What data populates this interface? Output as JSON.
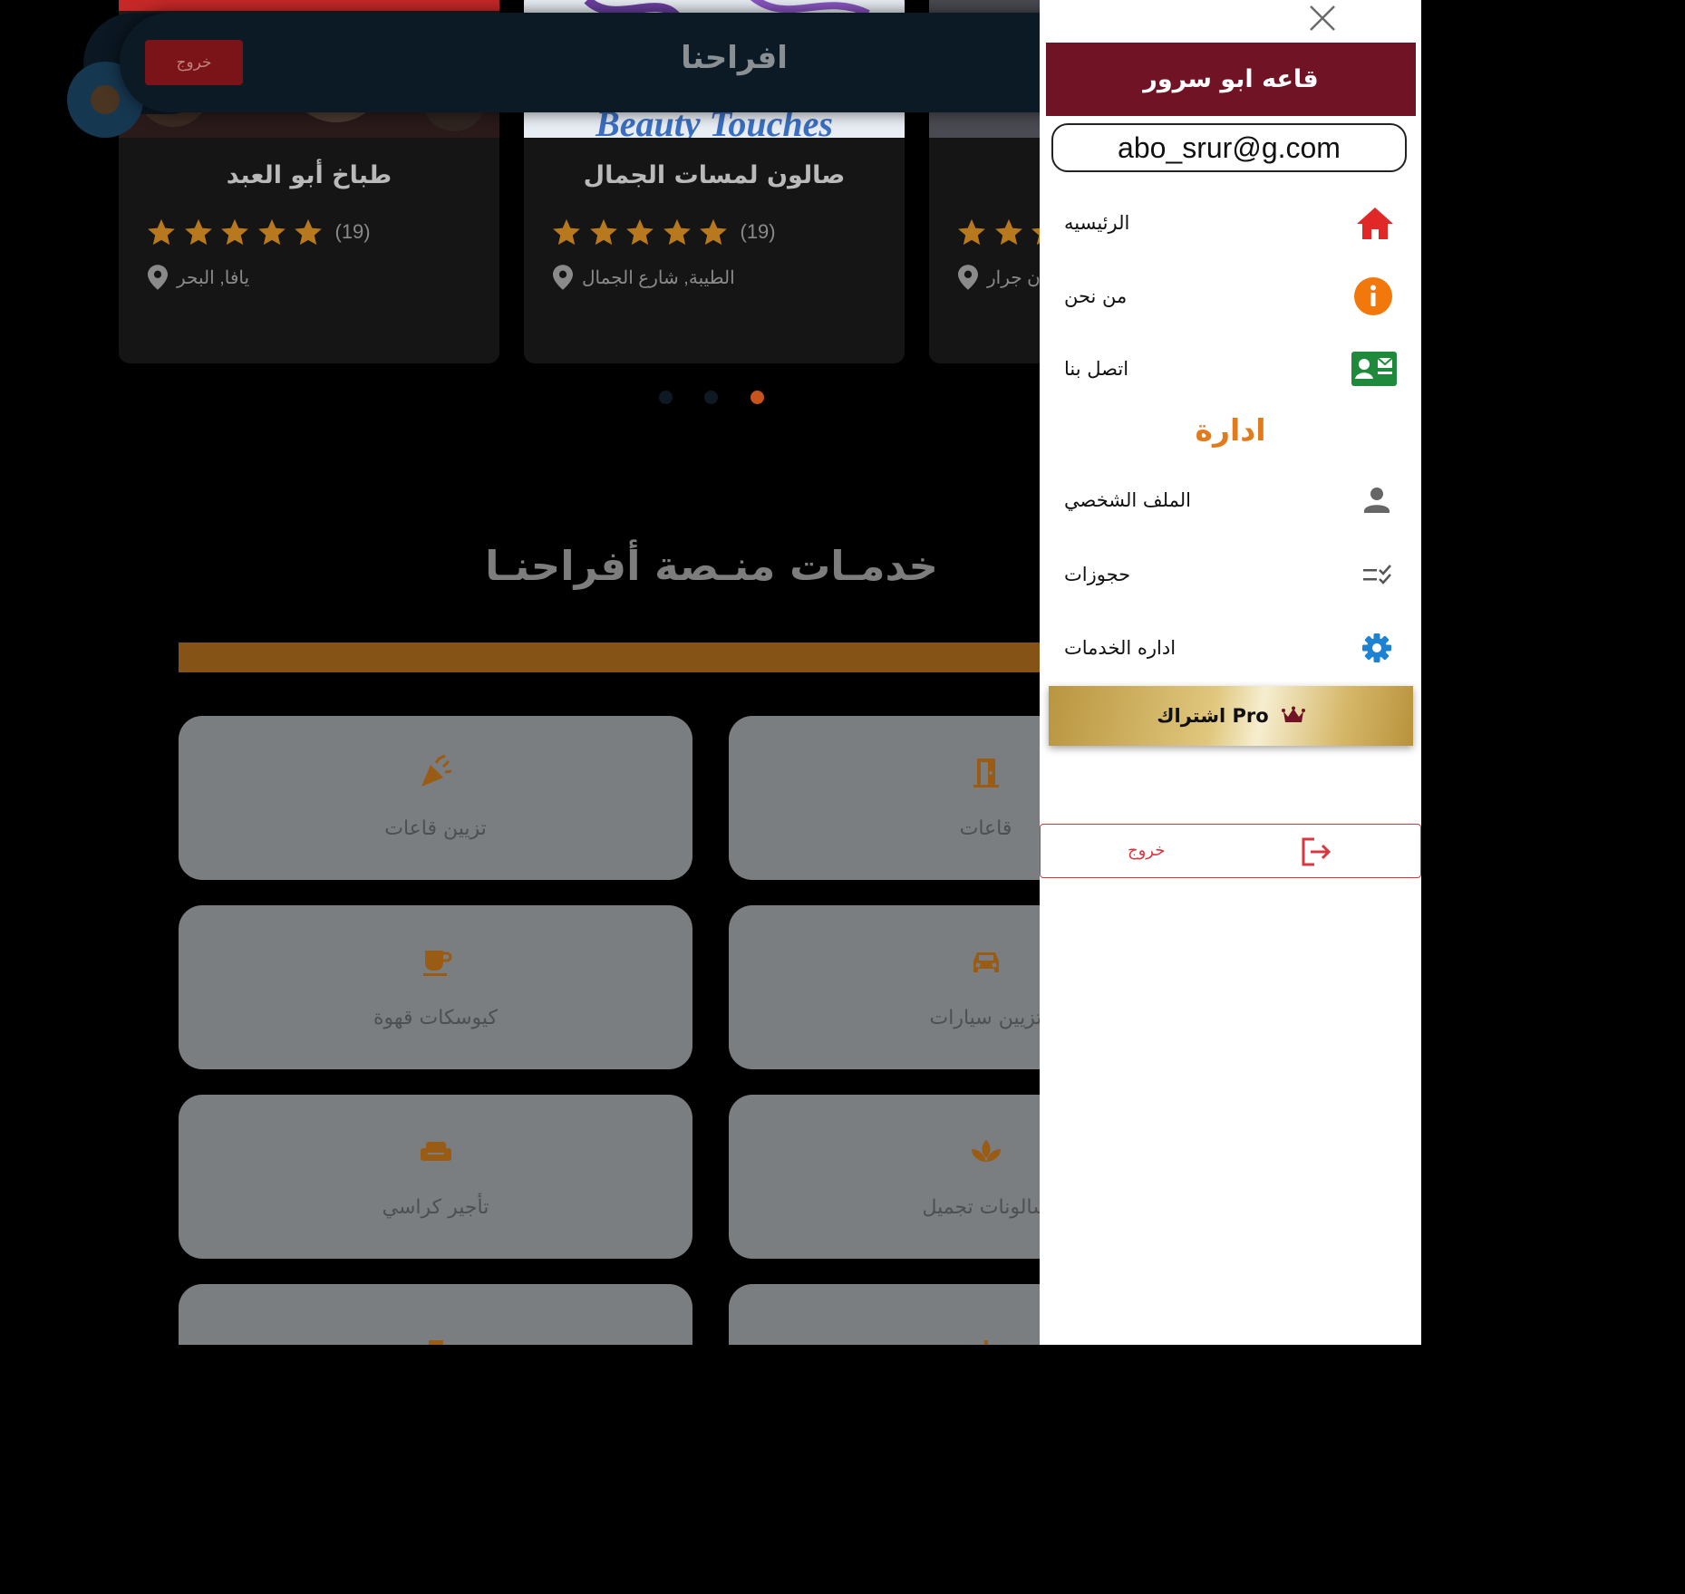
{
  "header": {
    "title": "افراحنا",
    "logout_label": "خروج"
  },
  "cards": [
    {
      "name": "طباخ أبو العبد",
      "rating": 5,
      "reviews": "(19)",
      "location": "يافا, البحر"
    },
    {
      "name": "صالون لمسات الجمال",
      "rating": 5,
      "reviews": "(19)",
      "location": "الطيبة, شارع الجمال",
      "image_text": "Beauty Touches"
    },
    {
      "name": "",
      "rating": 5,
      "reviews": "",
      "location": "ن جرار"
    }
  ],
  "carousel": {
    "pages": 3,
    "active": 3,
    "active_color": "#c7541a"
  },
  "services": {
    "title": "خدمـات منـصة أفراحنـا",
    "items": [
      {
        "label": "قاعات",
        "icon": "door-icon"
      },
      {
        "label": "تزيين قاعات",
        "icon": "party-popper-icon"
      },
      {
        "label": "تزيين سيارات",
        "icon": "car-icon"
      },
      {
        "label": "كيوسكات قهوة",
        "icon": "coffee-icon"
      },
      {
        "label": "سالونات تجميل",
        "icon": "spa-icon"
      },
      {
        "label": "تأجير كراسي",
        "icon": "couch-icon"
      }
    ]
  },
  "drawer": {
    "user_name": "قاعه ابو سرور",
    "email": "abo_srur@g.com",
    "menu": [
      {
        "label": "الرئيسيه",
        "icon": "home-icon"
      },
      {
        "label": "من نحن",
        "icon": "info-icon"
      },
      {
        "label": "اتصل بنا",
        "icon": "contact-card-icon"
      }
    ],
    "admin_heading": "ادارة",
    "admin_menu": [
      {
        "label": "الملف الشخصي",
        "icon": "user-icon"
      },
      {
        "label": "حجوزات",
        "icon": "checklist-icon"
      },
      {
        "label": "اداره الخدمات",
        "icon": "gear-icon"
      }
    ],
    "pro_label": "اشتراك Pro",
    "logout_label": "خروج"
  },
  "colors": {
    "drawer_name_bg": "#6f1325",
    "admin_heading": "#e07c1e",
    "service_bar": "#855315",
    "logout_red": "#d8373f"
  }
}
